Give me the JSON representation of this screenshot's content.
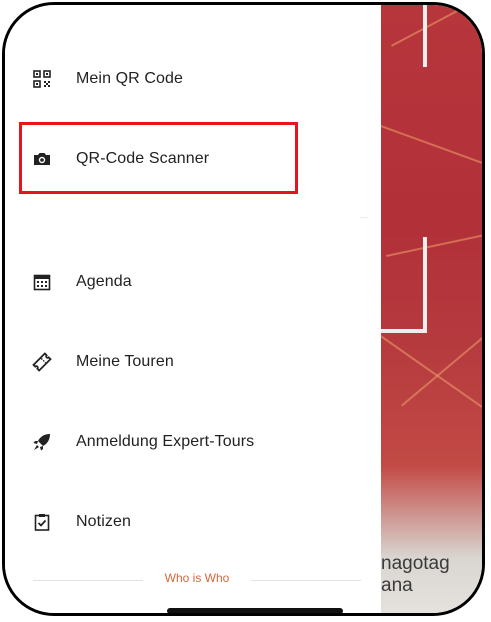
{
  "menu": {
    "items": [
      {
        "label": "Mein QR Code",
        "icon": "qr-code-icon"
      },
      {
        "label": "QR-Code Scanner",
        "icon": "camera-icon"
      },
      {
        "label": "Agenda",
        "icon": "calendar-icon"
      },
      {
        "label": "Meine Touren",
        "icon": "ticket-icon"
      },
      {
        "label": "Anmeldung Expert-Tours",
        "icon": "rocket-icon"
      },
      {
        "label": "Notizen",
        "icon": "clipboard-check-icon"
      }
    ],
    "section_label": "Who is Who"
  },
  "camera_view": {
    "text_line_1": "nagotag",
    "text_line_2": "ana"
  },
  "colors": {
    "highlight": "#e5141d",
    "section_label": "#d0693b",
    "camera_red": "#b23038"
  }
}
